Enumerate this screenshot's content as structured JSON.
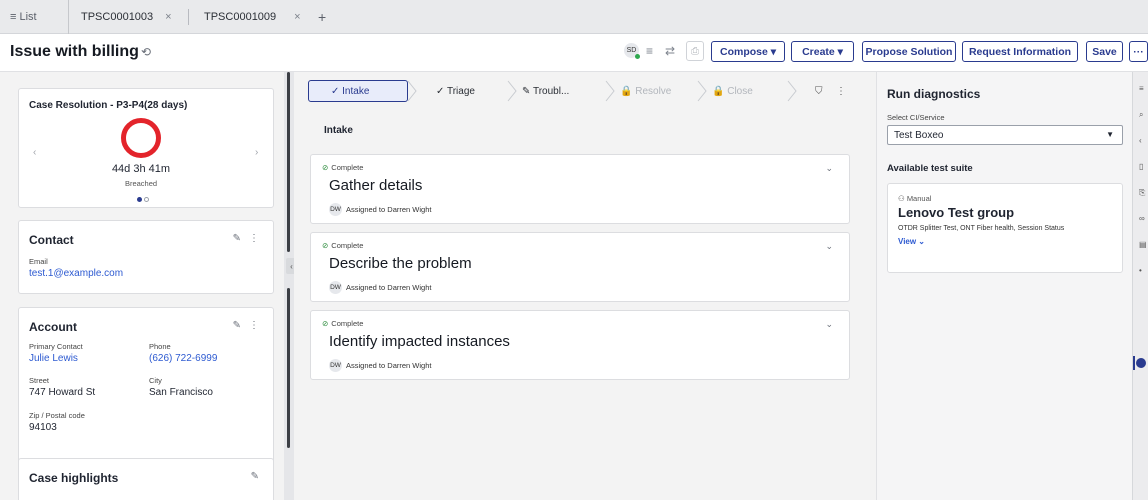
{
  "tabs": {
    "list_label": "≡ List",
    "tab1": "TPSC0001003",
    "tab2": "TPSC0001009",
    "close": "×",
    "add": "+"
  },
  "header": {
    "title": "Issue with billing",
    "avatar": "SD",
    "buttons": {
      "compose": "Compose ▾",
      "create": "Create ▾",
      "propose": "Propose Solution",
      "request": "Request Information",
      "save": "Save",
      "more": "···"
    }
  },
  "case_resolution": {
    "title": "Case Resolution - P3-P4(28 days)",
    "time": "44d 3h 41m",
    "status": "Breached",
    "ring_color": "#e3242b"
  },
  "contact": {
    "title": "Contact",
    "email_label": "Email",
    "email": "test.1@example.com"
  },
  "account": {
    "title": "Account",
    "primary_contact_label": "Primary Contact",
    "primary_contact": "Julie Lewis",
    "phone_label": "Phone",
    "phone": "(626) 722-6999",
    "street_label": "Street",
    "street": "747 Howard St",
    "city_label": "City",
    "city": "San Francisco",
    "zip_label": "Zip / Postal code",
    "zip": "94103"
  },
  "case_highlights": {
    "title": "Case highlights"
  },
  "stepper": {
    "steps": [
      "✓ Intake",
      "✓ Triage",
      "✎ Troubl...",
      "🔒 Resolve",
      "🔒 Close"
    ]
  },
  "intake": {
    "label": "Intake",
    "tasks": [
      {
        "status": "Complete",
        "title": "Gather details",
        "initials": "DW",
        "assigned": "Assigned to Darren Wight"
      },
      {
        "status": "Complete",
        "title": "Describe the problem",
        "initials": "DW",
        "assigned": "Assigned to Darren Wight"
      },
      {
        "status": "Complete",
        "title": "Identify impacted instances",
        "initials": "DW",
        "assigned": "Assigned to Darren Wight"
      }
    ]
  },
  "diagnostics": {
    "title": "Run diagnostics",
    "select_label": "Select CI/Service",
    "select_value": "Test Boxeo",
    "suite_label": "Available test suite",
    "suite": {
      "type": "Manual",
      "name": "Lenovo Test group",
      "description": "OTDR Splitter Test, ONT Fiber health, Session Status",
      "view": "View ⌄"
    }
  },
  "colors": {
    "accent": "#2a3b8f",
    "link": "#2d5ad1",
    "breached": "#e3242b"
  }
}
